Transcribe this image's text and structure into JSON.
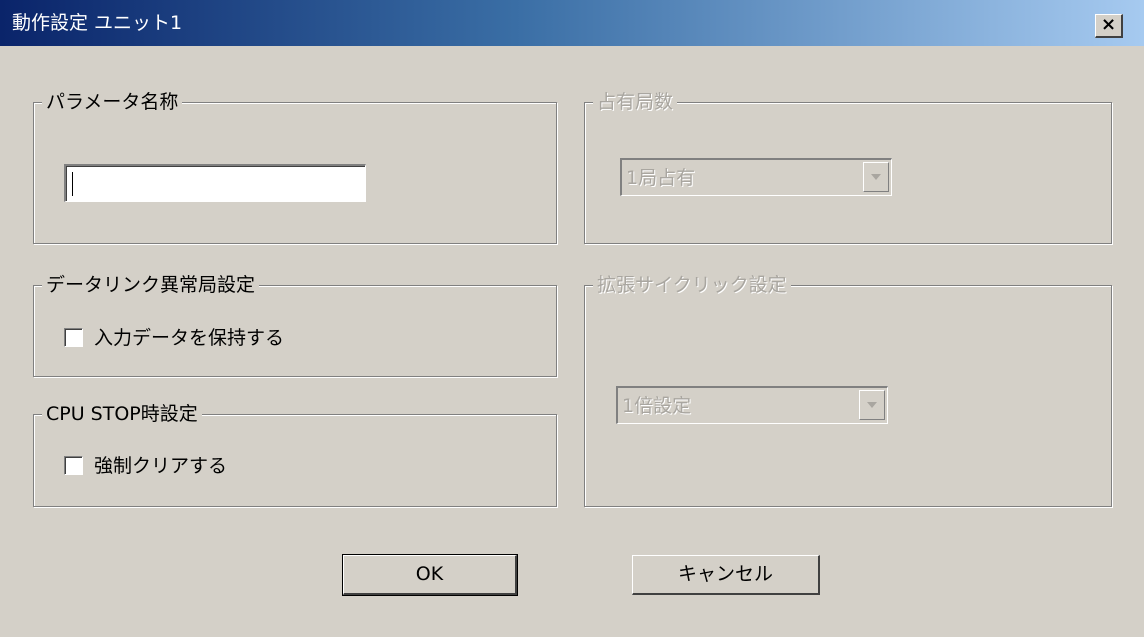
{
  "window": {
    "title": "動作設定 ユニット1",
    "close_symbol": "×"
  },
  "parameter_name": {
    "label": "パラメータ名称",
    "value": ""
  },
  "occupied_stations": {
    "label": "占有局数",
    "selected": "1局占有",
    "disabled": true
  },
  "data_link_error": {
    "label": "データリンク異常局設定",
    "checkbox_label": "入力データを保持する",
    "checked": false
  },
  "extended_cyclic": {
    "label": "拡張サイクリック設定",
    "selected": "1倍設定",
    "disabled": true
  },
  "cpu_stop": {
    "label": "CPU STOP時設定",
    "checkbox_label": "強制クリアする",
    "checked": false
  },
  "buttons": {
    "ok": "OK",
    "cancel": "キャンセル"
  },
  "icons": {
    "close": "close-icon",
    "dropdown": "chevron-down-icon"
  }
}
